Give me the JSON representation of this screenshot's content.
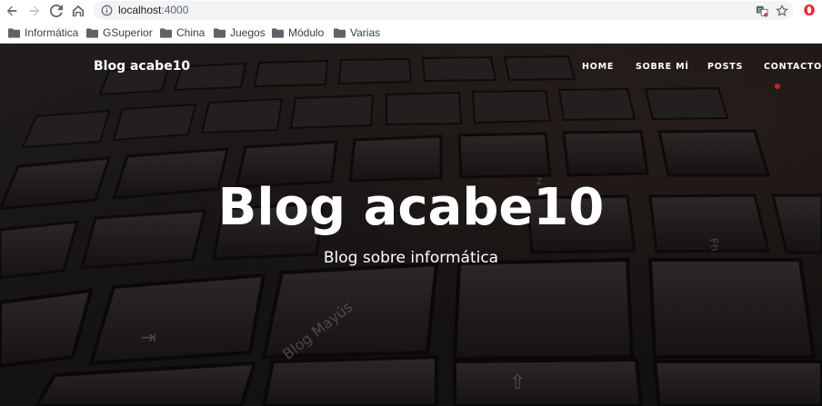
{
  "browser": {
    "url_host": "localhost",
    "url_port": ":4000"
  },
  "bookmarks": [
    {
      "label": "Informática"
    },
    {
      "label": "GSuperior"
    },
    {
      "label": "China"
    },
    {
      "label": "Juegos"
    },
    {
      "label": "Módulo"
    },
    {
      "label": "Varias"
    }
  ],
  "site": {
    "brand": "Blog acabe10",
    "nav": {
      "home": "HOME",
      "about": "SOBRE MÍ",
      "posts": "POSTS",
      "contact": "CONTACTO"
    },
    "hero_title": "Blog acabe10",
    "hero_subtitle": "Blog sobre informática"
  },
  "colors": {
    "accent_dot": "#e0261b",
    "opera_red": "#ff1b2d"
  }
}
